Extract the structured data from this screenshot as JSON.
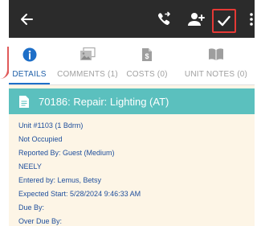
{
  "toolbar": {
    "icons": [
      "arrow-left-icon",
      "phone-forward-icon",
      "add-user-icon",
      "check-icon",
      "more-vertical-icon"
    ]
  },
  "tabs": [
    {
      "label": "DETAILS",
      "icon": "info-icon",
      "active": true
    },
    {
      "label": "COMMENTS (1)",
      "icon": "photo-icon",
      "active": false
    },
    {
      "label": "COSTS (0)",
      "icon": "dollar-doc-icon",
      "active": false
    },
    {
      "label": "UNIT NOTES (0)",
      "icon": "book-icon",
      "active": false
    }
  ],
  "work_order": {
    "title": "70186: Repair: Lighting (AT)"
  },
  "details": [
    "Unit #1103 (1 Bdrm)",
    "Not Occupied",
    "Reported By: Guest  (Medium)",
    "NEELY",
    "Entered by: Lemus, Betsy",
    "Expected Start: 5/28/2024 9:46:33 AM",
    "Due By:",
    "Over Due By:"
  ],
  "colors": {
    "topbar": "#2b2b2b",
    "accent_teal": "#5bc0be",
    "active_tab": "#1e5fa8",
    "detail_text": "#1e4e9c",
    "highlight_box": "#e53935",
    "content_bg": "#fdf5e6"
  }
}
